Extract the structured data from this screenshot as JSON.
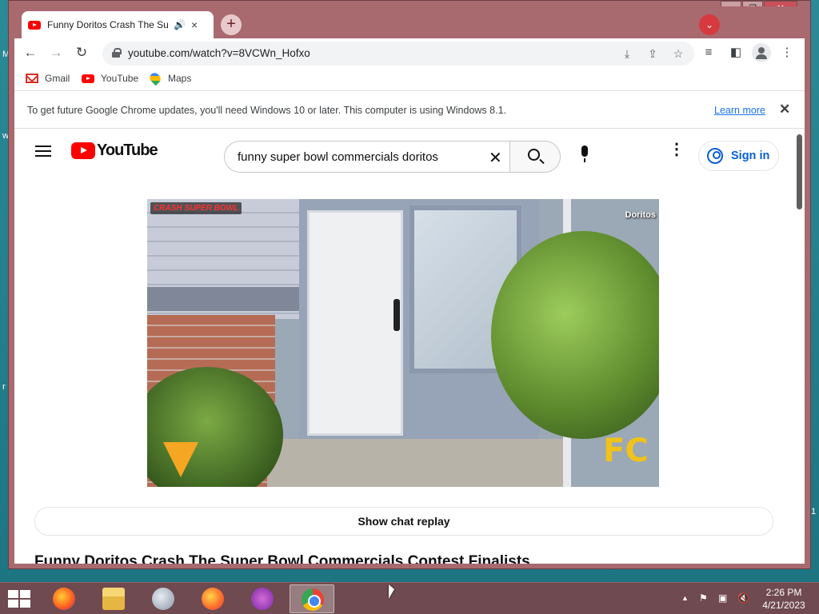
{
  "browser": {
    "tab": {
      "title": "Funny Doritos Crash The Super Bowl",
      "audio_icon": "speaker-icon",
      "close_icon": "×"
    },
    "new_tab": "+",
    "tab_search": "⌄",
    "window_controls": {
      "minimize": "—",
      "maximize": "❐",
      "close": "✕"
    },
    "url": "youtube.com/watch?v=8VCWn_Hofxo",
    "bookmarks": [
      {
        "label": "Gmail",
        "icon": "gmail-icon"
      },
      {
        "label": "YouTube",
        "icon": "youtube-icon"
      },
      {
        "label": "Maps",
        "icon": "maps-icon"
      }
    ],
    "infobar": {
      "message": "To get future Google Chrome updates, you'll need Windows 10 or later. This computer is using Windows 8.1.",
      "link": "Learn more",
      "close": "✕"
    }
  },
  "youtube": {
    "logo_text": "YouTube",
    "search_query": "funny super bowl commercials doritos",
    "clear": "✕",
    "more": "⋮",
    "sign_in": "Sign in",
    "video": {
      "badge_top_left": "CRASH SUPER BOWL",
      "badge_top_right": "Doritos",
      "corner_logo": "FC"
    },
    "show_chat_replay": "Show chat replay",
    "video_title": "Funny Doritos Crash The Super Bowl Commercials Contest Finalists"
  },
  "taskbar": {
    "apps": [
      "Firefox",
      "File Explorer",
      "Thunderbird",
      "Firefox",
      "Privacy app",
      "Google Chrome"
    ],
    "active_app": "Google Chrome",
    "tray": {
      "up_arrow": "▲",
      "flag": "⚑",
      "network": "▣",
      "volume": "🔇"
    },
    "time": "2:26 PM",
    "date": "4/21/2023"
  },
  "colors": {
    "window_frame": "#a8696f",
    "desktop": "#1f7a86",
    "taskbar": "#6f4a50",
    "youtube_red": "#ff0000",
    "link_blue": "#1a73e8",
    "signin_blue": "#065fd4"
  }
}
